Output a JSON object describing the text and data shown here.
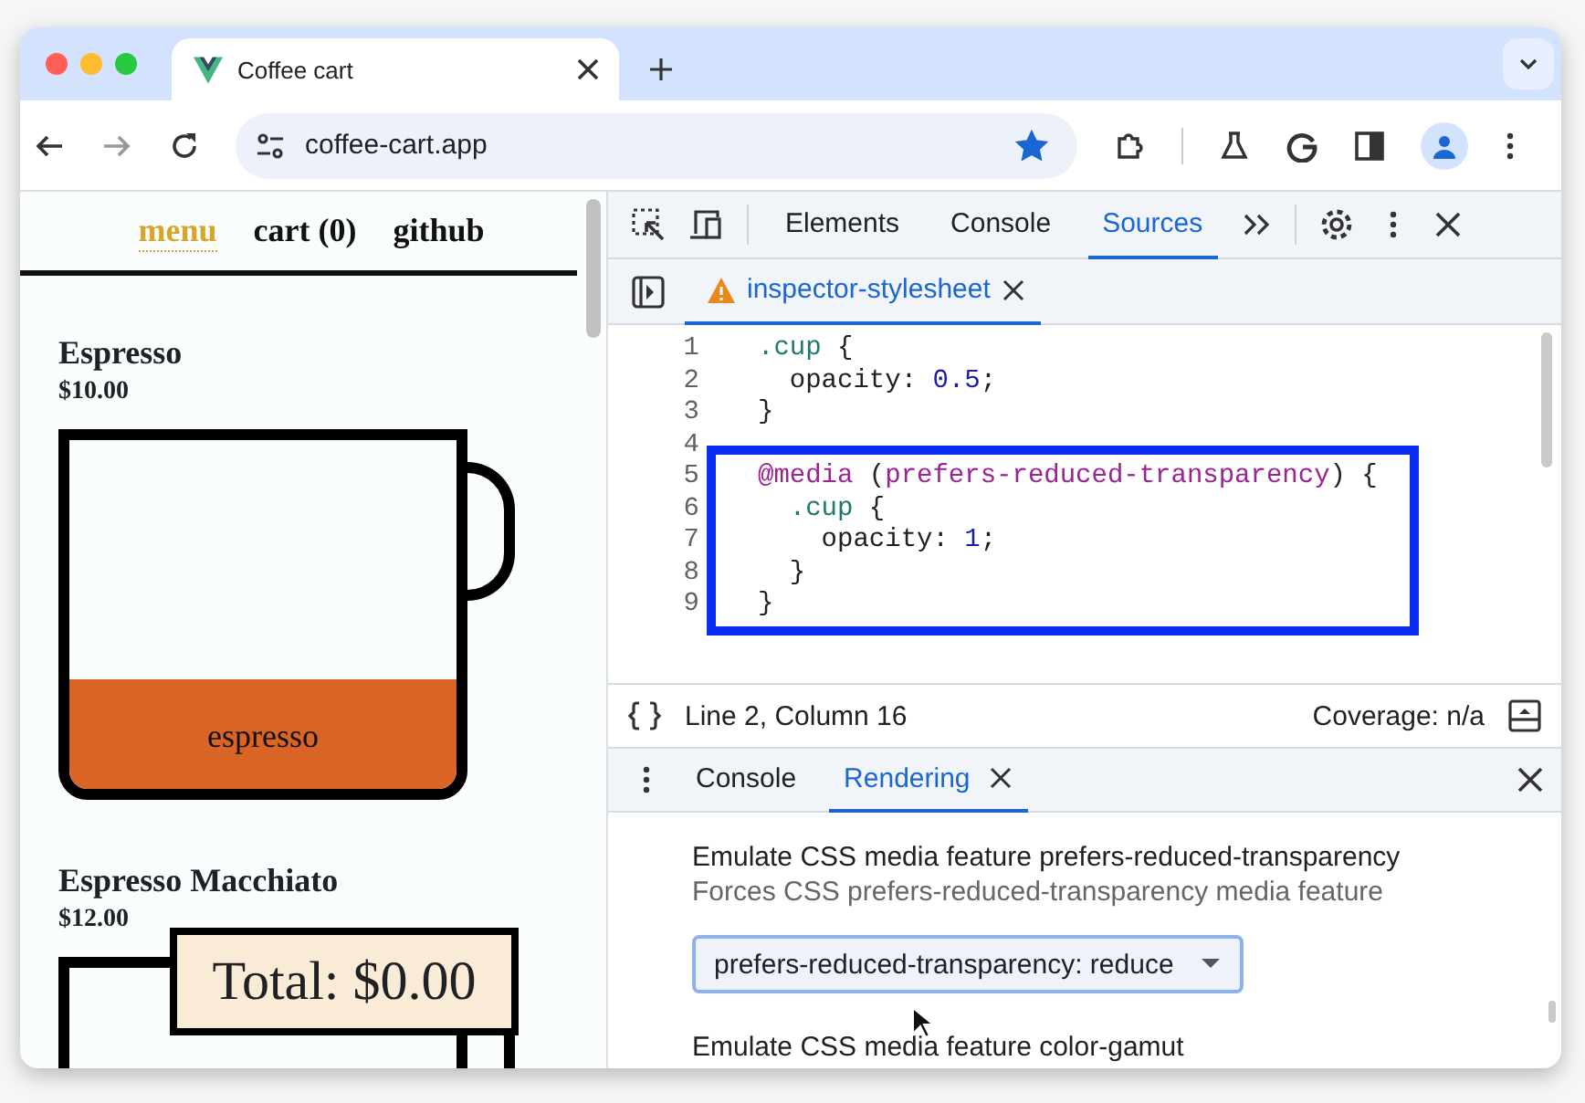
{
  "browser": {
    "tab": {
      "title": "Coffee cart"
    },
    "address": "coffee-cart.app",
    "bookmarked": true
  },
  "page": {
    "nav": [
      {
        "label": "menu",
        "selected": true
      },
      {
        "label": "cart (0)",
        "selected": false
      },
      {
        "label": "github",
        "selected": false
      }
    ],
    "items": [
      {
        "name": "Espresso",
        "price": "$10.00",
        "layers": [
          {
            "label": "espresso",
            "color": "#da6425"
          }
        ]
      },
      {
        "name": "Espresso Macchiato",
        "price": "$12.00"
      }
    ],
    "total": "Total: $0.00"
  },
  "devtools": {
    "tabs": [
      {
        "label": "Elements",
        "selected": false
      },
      {
        "label": "Console",
        "selected": false
      },
      {
        "label": "Sources",
        "selected": true
      }
    ],
    "file_tab": {
      "name": "inspector-stylesheet",
      "warning": true
    },
    "code": [
      {
        "number": "1",
        "highlighted": false,
        "tokens": [
          {
            "text": ".cup",
            "kind": "selector"
          },
          {
            "text": " {",
            "kind": "plain"
          }
        ]
      },
      {
        "number": "2",
        "highlighted": false,
        "tokens": [
          {
            "text": "  opacity: ",
            "kind": "plain"
          },
          {
            "text": "0.5",
            "kind": "number"
          },
          {
            "text": ";",
            "kind": "plain"
          }
        ]
      },
      {
        "number": "3",
        "highlighted": false,
        "tokens": [
          {
            "text": "}",
            "kind": "plain"
          }
        ]
      },
      {
        "number": "4",
        "highlighted": false
      },
      {
        "number": "5",
        "highlighted": true,
        "tokens": [
          {
            "text": "@media",
            "kind": "atrule"
          },
          {
            "text": " (",
            "kind": "plain"
          },
          {
            "text": "prefers-reduced-transparency",
            "kind": "atrule"
          },
          {
            "text": ") {",
            "kind": "plain"
          }
        ]
      },
      {
        "number": "6",
        "highlighted": true,
        "tokens": [
          {
            "text": "  .cup",
            "kind": "selector"
          },
          {
            "text": " {",
            "kind": "plain"
          }
        ]
      },
      {
        "number": "7",
        "highlighted": true,
        "tokens": [
          {
            "text": "    opacity: ",
            "kind": "plain"
          },
          {
            "text": "1",
            "kind": "number"
          },
          {
            "text": ";",
            "kind": "plain"
          }
        ]
      },
      {
        "number": "8",
        "highlighted": true,
        "tokens": [
          {
            "text": "  }",
            "kind": "plain"
          }
        ]
      },
      {
        "number": "9",
        "highlighted": true,
        "tokens": [
          {
            "text": "}",
            "kind": "plain"
          }
        ]
      }
    ],
    "status": {
      "position": "Line 2, Column 16",
      "coverage": "Coverage: n/a"
    },
    "drawer": {
      "tabs": [
        {
          "label": "Console",
          "selected": false,
          "closable": false
        },
        {
          "label": "Rendering",
          "selected": true,
          "closable": true
        }
      ],
      "sections": [
        {
          "title": "Emulate CSS media feature prefers-reduced-transparency",
          "description": "Forces CSS prefers-reduced-transparency media feature",
          "select": "prefers-reduced-transparency: reduce"
        },
        {
          "title": "Emulate CSS media feature color-gamut"
        }
      ]
    }
  }
}
